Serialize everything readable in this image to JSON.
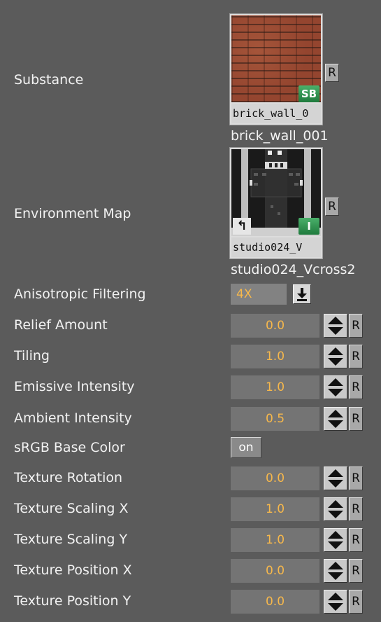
{
  "substance": {
    "label": "Substance",
    "thumb_caption": "brick_wall_0",
    "badge": "SB",
    "name": "brick_wall_001",
    "reset": "R"
  },
  "environment_map": {
    "label": "Environment Map",
    "thumb_caption": "studio024_V",
    "badge": "I",
    "link_glyph": "↰",
    "name": "studio024_Vcross2",
    "reset": "R"
  },
  "anisotropic": {
    "label": "Anisotropic Filtering",
    "value": "4X",
    "dropdown_icon": "download-arrow-icon"
  },
  "fields": [
    {
      "label": "Relief Amount",
      "value": "0.0",
      "reset": "R"
    },
    {
      "label": "Tiling",
      "value": "1.0",
      "reset": "R"
    },
    {
      "label": "Emissive Intensity",
      "value": "1.0",
      "reset": "R"
    },
    {
      "label": "Ambient Intensity",
      "value": "0.5",
      "reset": "R"
    }
  ],
  "srgb": {
    "label": "sRGB Base Color",
    "value": "on"
  },
  "fields2": [
    {
      "label": "Texture Rotation",
      "value": "0.0",
      "reset": "R"
    },
    {
      "label": "Texture Scaling X",
      "value": "1.0",
      "reset": "R"
    },
    {
      "label": "Texture Scaling Y",
      "value": "1.0",
      "reset": "R"
    },
    {
      "label": "Texture Position X",
      "value": "0.0",
      "reset": "R"
    },
    {
      "label": "Texture Position Y",
      "value": "0.0",
      "reset": "R"
    }
  ],
  "colors": {
    "background": "#5b5b5b",
    "value_text": "#f7b84b",
    "field_bg": "#747474"
  }
}
